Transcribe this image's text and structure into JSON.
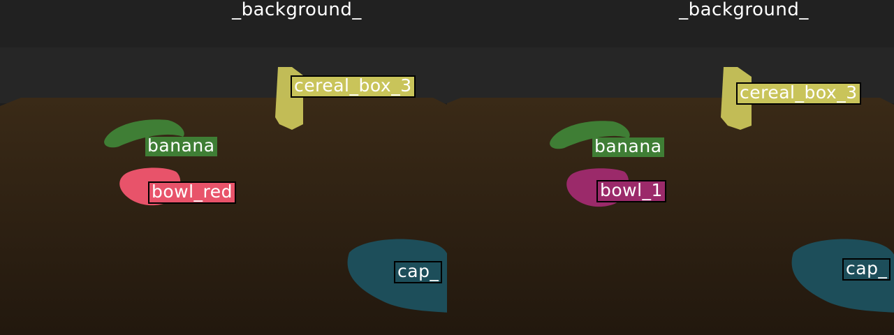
{
  "panes": [
    {
      "background_label": "_background_",
      "labels": {
        "cereal": "cereal_box_3",
        "banana": "banana",
        "bowl": "bowl_red",
        "cap": "cap_"
      },
      "colors": {
        "cereal": "#c9c45a",
        "banana": "#3f7e35",
        "bowl": "#e8536a",
        "cap": "#1d4e5a"
      }
    },
    {
      "background_label": "_background_",
      "labels": {
        "cereal": "cereal_box_3",
        "banana": "banana",
        "bowl": "bowl_1",
        "cap": "cap_"
      },
      "colors": {
        "cereal": "#c9c45a",
        "banana": "#3f7e35",
        "bowl": "#9b2a6a",
        "cap": "#1d4e5a"
      }
    }
  ]
}
